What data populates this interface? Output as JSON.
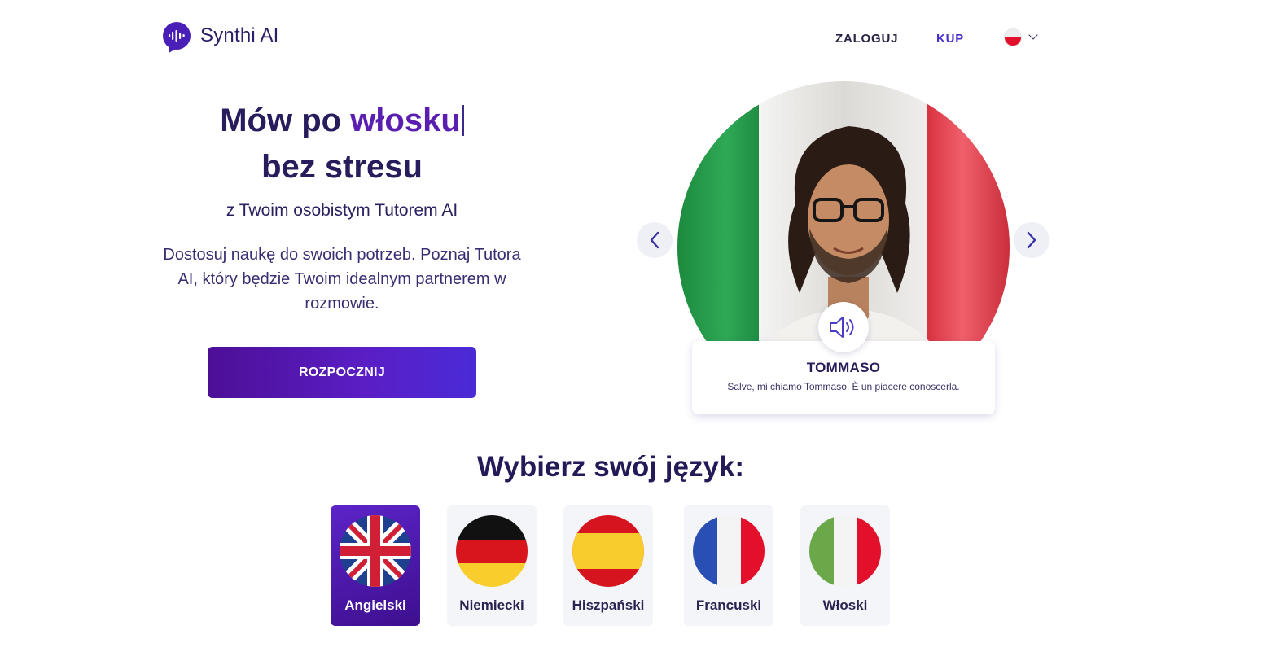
{
  "header": {
    "brand": "Synthi AI",
    "login_label": "ZALOGUJ",
    "buy_label": "KUP",
    "ui_language_flag": "poland-flag-icon"
  },
  "hero": {
    "title_prefix": "Mów po ",
    "title_highlight": "włosku",
    "title_line2": "bez stresu",
    "subtitle": "z Twoim osobistym Tutorem AI",
    "description": "Dostosuj naukę do swoich potrzeb. Poznaj Tutora AI, który będzie Twoim idealnym partnerem w rozmowie.",
    "cta_label": "ROZPOCZNIJ"
  },
  "tutor": {
    "name": "TOMMASO",
    "greeting": "Salve, mi chiamo Tommaso. È un piacere conoscerla.",
    "background_flag": "italy-flag"
  },
  "language_picker": {
    "title": "Wybierz swój język:",
    "selected": "Angielski",
    "languages": [
      {
        "label": "Angielski",
        "flag": "uk-flag-icon"
      },
      {
        "label": "Niemiecki",
        "flag": "germany-flag-icon"
      },
      {
        "label": "Hiszpański",
        "flag": "spain-flag-icon"
      },
      {
        "label": "Francuski",
        "flag": "france-flag-icon"
      },
      {
        "label": "Włoski",
        "flag": "italy-flag-icon"
      }
    ]
  },
  "colors": {
    "brand": "#4a1fb8",
    "heading": "#281c5c",
    "accent": "#5a1fb0",
    "buy_link": "#4b2fc9"
  }
}
